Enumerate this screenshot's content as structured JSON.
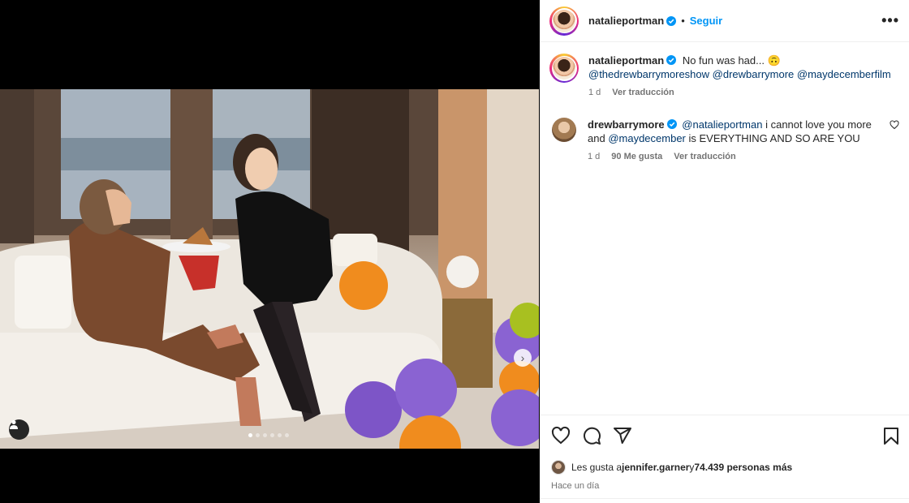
{
  "post": {
    "author": "natalieportman",
    "follow_label": "Seguir",
    "bullet": "•",
    "more_label": "•••",
    "caption_text": "No fun was had... 🙃",
    "caption_mentions": [
      "@thedrewbarrymoreshow",
      "@drewbarrymore",
      "@maydecemberfilm"
    ],
    "caption_time": "1 d",
    "caption_translate": "Ver traducción"
  },
  "comment": {
    "author": "drewbarrymore",
    "mention1": "@natalieportman",
    "text1": " i cannot love you more and ",
    "mention2": "@maydecember",
    "text2": " is EVERYTHING AND SO ARE YOU",
    "time": "1 d",
    "likes": "90 Me gusta",
    "translate": "Ver traducción"
  },
  "likes": {
    "prefix": "Les gusta a ",
    "user": "jennifer.garner",
    "middle": " y ",
    "count": "74.439 personas más",
    "ago": "Hace un día"
  },
  "carousel": {
    "total": 6,
    "active": 1
  },
  "colors": {
    "link_blue": "#0095f6",
    "mention": "#00376b",
    "verified": "#0095f6"
  },
  "icons": [
    "heart-icon",
    "comment-icon",
    "share-icon",
    "bookmark-icon",
    "chevron-right-icon",
    "user-tag-icon",
    "verified-icon",
    "more-icon"
  ]
}
